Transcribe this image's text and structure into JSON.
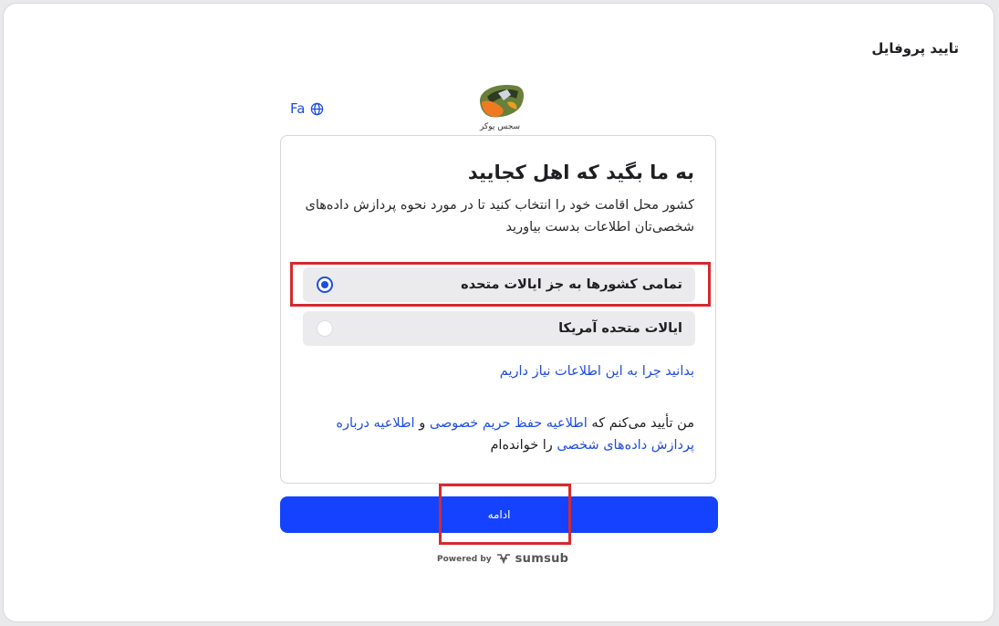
{
  "page": {
    "title": "تایید پروفایل"
  },
  "language": {
    "label": "Fa",
    "icon": "globe-icon"
  },
  "logo": {
    "text": "سجس پوکر",
    "icon": "brand-logo-icon"
  },
  "card": {
    "heading": "به ما بگید که اهل کجایید",
    "description": "کشور محل اقامت خود را انتخاب کنید تا در مورد نحوه پردازش داده‌های شخصی‌تان اطلاعات بدست بیاورید",
    "options": [
      {
        "label": "تمامی کشورها به جز ایالات متحده",
        "selected": true
      },
      {
        "label": "ایالات متحده آمریکا",
        "selected": false
      }
    ],
    "why_link": "بدانید چرا به این اطلاعات نیاز داریم",
    "consent": {
      "prefix": "من تأیید می‌کنم که",
      "privacy_link": "اطلاعیه حفظ حریم خصوصی",
      "and": "و",
      "processing_link": "اطلاعیه درباره پردازش داده‌های شخصی",
      "suffix": "را خوانده‌ام"
    }
  },
  "continue_button": {
    "label": "ادامه"
  },
  "footer": {
    "powered_by": "Powered by",
    "brand": "sumsub",
    "icon": "sumsub-logo-icon"
  },
  "colors": {
    "accent": "#1542ff",
    "link": "#1f4de0",
    "highlight": "#d42a2f"
  }
}
